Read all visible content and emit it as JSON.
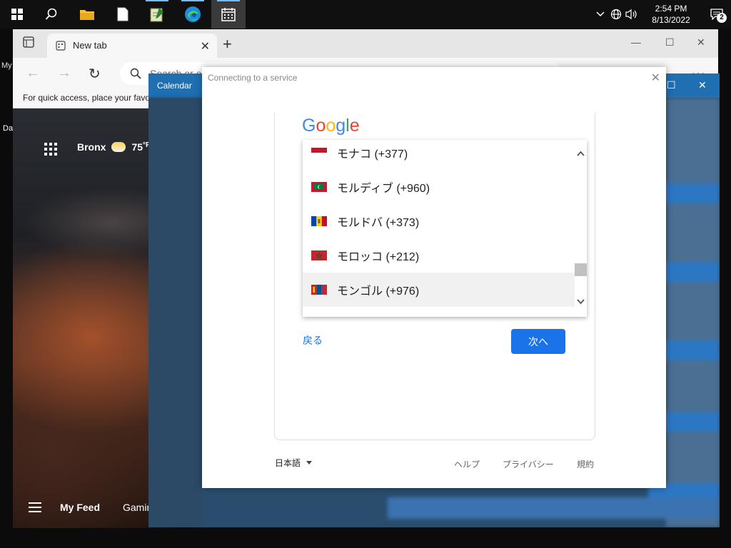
{
  "taskbar": {
    "clock_time": "2:54 PM",
    "clock_date": "8/13/2022",
    "notification_count": "2",
    "apps": [
      "start",
      "search",
      "file-explorer",
      "notepad",
      "task-app",
      "edge",
      "calendar"
    ]
  },
  "edge": {
    "tab_title": "New tab",
    "address_placeholder": "Search or e",
    "favorites_bar_text": "For quick access, place your favo",
    "left_clip_label_1": "My",
    "left_clip_label_2": "Da",
    "weather_city": "Bronx",
    "weather_temp": "75",
    "weather_unit": "°F",
    "feed_items": [
      "My Feed",
      "Gamin"
    ]
  },
  "calendar": {
    "title": "Calendar"
  },
  "dialog": {
    "title": "Connecting to a service",
    "logo_text": "Google",
    "back_label": "戻る",
    "next_label": "次へ",
    "language": "日本語",
    "footer_links": [
      "ヘルプ",
      "プライバシー",
      "規約"
    ],
    "country_options": [
      {
        "label": "モナコ (+377)",
        "flag": "monaco",
        "highlighted": false
      },
      {
        "label": "モルディブ (+960)",
        "flag": "maldives",
        "highlighted": false
      },
      {
        "label": "モルドバ (+373)",
        "flag": "moldova",
        "highlighted": false
      },
      {
        "label": "モロッコ (+212)",
        "flag": "morocco",
        "highlighted": false
      },
      {
        "label": "モンゴル (+976)",
        "flag": "mongolia",
        "highlighted": true
      }
    ]
  },
  "colors": {
    "accent": "#1a73e8",
    "calendar_titlebar": "#1f6fb3",
    "taskbar": "#101010"
  }
}
